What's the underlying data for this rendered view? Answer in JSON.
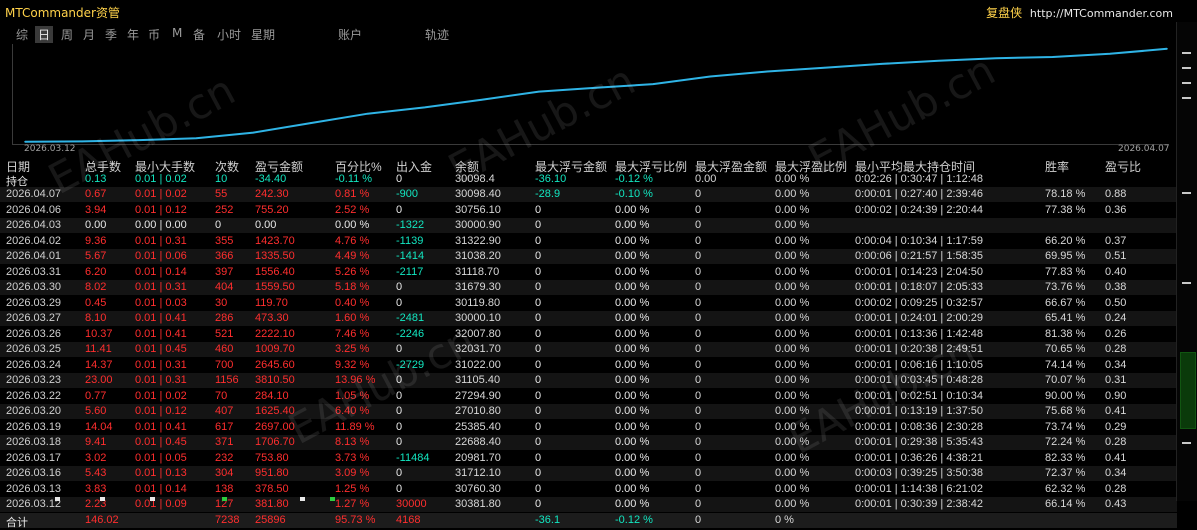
{
  "window": {
    "title": "MTCommander资管",
    "brand": "复盘侠",
    "url": "http://MTCommander.com"
  },
  "tabs": [
    "综",
    "日",
    "周",
    "月",
    "季",
    "年",
    "币",
    "M",
    "备",
    "小时",
    "星期",
    "账户",
    "轨迹"
  ],
  "active_tab": "日",
  "chart_data": {
    "type": "line",
    "x_start_label": "2026.03.12",
    "x_end_label": "2026.04.07",
    "x": [
      "2026.03.12",
      "2026.03.13",
      "2026.03.16",
      "2026.03.17",
      "2026.03.18",
      "2026.03.19",
      "2026.03.20",
      "2026.03.22",
      "2026.03.23",
      "2026.03.24",
      "2026.03.25",
      "2026.03.26",
      "2026.03.27",
      "2026.03.29",
      "2026.03.30",
      "2026.03.31",
      "2026.04.01",
      "2026.04.02",
      "2026.04.03",
      "2026.04.06",
      "2026.04.07"
    ],
    "values": [
      0.4,
      0.9,
      3,
      6,
      15,
      30,
      45,
      55,
      67,
      80,
      86,
      92,
      104,
      112,
      118,
      124,
      129,
      133,
      135,
      140,
      148
    ],
    "line_color": "#2fb4e6",
    "grid": false
  },
  "table": {
    "headers": [
      "日期",
      "总手数",
      "最小大手数",
      "次数",
      "盈亏金额",
      "百分比%",
      "出入金",
      "余额",
      "最大浮亏金额",
      "最大浮亏比例",
      "最大浮盈金额",
      "最大浮盈比例",
      "最小平均最大持仓时间",
      "胜率",
      "盈亏比"
    ],
    "holding": [
      "持仓",
      "0.13",
      "0.01 | 0.02",
      "10",
      "-34.40",
      "-0.11 %",
      "0",
      "30098.4",
      "-36.10",
      "-0.12 %",
      "0.00",
      "0.00 %",
      "0:02:26 | 0:30:47 | 1:12:48",
      "",
      ""
    ],
    "rows": [
      [
        "2026.04.07",
        "0.67",
        "0.01 | 0.02",
        "55",
        "242.30",
        "0.81 %",
        "-900",
        "30098.40",
        "-28.9",
        "-0.10 %",
        "0",
        "0.00 %",
        "0:00:01 | 0:27:40 | 2:39:46",
        "78.18 %",
        "0.88"
      ],
      [
        "2026.04.06",
        "3.94",
        "0.01 | 0.12",
        "252",
        "755.20",
        "2.52 %",
        "0",
        "30756.10",
        "0",
        "0.00 %",
        "0",
        "0.00 %",
        "0:00:02 | 0:24:39 | 2:20:44",
        "77.38 %",
        "0.36"
      ],
      [
        "2026.04.03",
        "0.00",
        "0.00 | 0.00",
        "0",
        "0.00",
        "0.00 %",
        "-1322",
        "30000.90",
        "0",
        "0.00 %",
        "0",
        "0.00 %",
        "",
        "",
        ""
      ],
      [
        "2026.04.02",
        "9.36",
        "0.01 | 0.31",
        "355",
        "1423.70",
        "4.76 %",
        "-1139",
        "31322.90",
        "0",
        "0.00 %",
        "0",
        "0.00 %",
        "0:00:04 | 0:10:34 | 1:17:59",
        "66.20 %",
        "0.37"
      ],
      [
        "2026.04.01",
        "5.67",
        "0.01 | 0.06",
        "366",
        "1335.50",
        "4.49 %",
        "-1414",
        "31038.20",
        "0",
        "0.00 %",
        "0",
        "0.00 %",
        "0:00:06 | 0:21:57 | 1:58:35",
        "69.95 %",
        "0.51"
      ],
      [
        "2026.03.31",
        "6.20",
        "0.01 | 0.14",
        "397",
        "1556.40",
        "5.26 %",
        "-2117",
        "31118.70",
        "0",
        "0.00 %",
        "0",
        "0.00 %",
        "0:00:01 | 0:14:23 | 2:04:50",
        "77.83 %",
        "0.40"
      ],
      [
        "2026.03.30",
        "8.02",
        "0.01 | 0.31",
        "404",
        "1559.50",
        "5.18 %",
        "0",
        "31679.30",
        "0",
        "0.00 %",
        "0",
        "0.00 %",
        "0:00:01 | 0:18:07 | 2:05:33",
        "73.76 %",
        "0.38"
      ],
      [
        "2026.03.29",
        "0.45",
        "0.01 | 0.03",
        "30",
        "119.70",
        "0.40 %",
        "0",
        "30119.80",
        "0",
        "0.00 %",
        "0",
        "0.00 %",
        "0:00:02 | 0:09:25 | 0:32:57",
        "66.67 %",
        "0.50"
      ],
      [
        "2026.03.27",
        "8.10",
        "0.01 | 0.41",
        "286",
        "473.30",
        "1.60 %",
        "-2481",
        "30000.10",
        "0",
        "0.00 %",
        "0",
        "0.00 %",
        "0:00:01 | 0:24:01 | 2:00:29",
        "65.41 %",
        "0.24"
      ],
      [
        "2026.03.26",
        "10.37",
        "0.01 | 0.41",
        "521",
        "2222.10",
        "7.46 %",
        "-2246",
        "32007.80",
        "0",
        "0.00 %",
        "0",
        "0.00 %",
        "0:00:01 | 0:13:36 | 1:42:48",
        "81.38 %",
        "0.26"
      ],
      [
        "2026.03.25",
        "11.41",
        "0.01 | 0.45",
        "460",
        "1009.70",
        "3.25 %",
        "0",
        "32031.70",
        "0",
        "0.00 %",
        "0",
        "0.00 %",
        "0:00:01 | 0:20:38 | 2:49:51",
        "70.65 %",
        "0.28"
      ],
      [
        "2026.03.24",
        "14.37",
        "0.01 | 0.31",
        "700",
        "2645.60",
        "9.32 %",
        "-2729",
        "31022.00",
        "0",
        "0.00 %",
        "0",
        "0.00 %",
        "0:00:01 | 0:06:16 | 1:10:05",
        "74.14 %",
        "0.34"
      ],
      [
        "2026.03.23",
        "23.00",
        "0.01 | 0.31",
        "1156",
        "3810.50",
        "13.96 %",
        "0",
        "31105.40",
        "0",
        "0.00 %",
        "0",
        "0.00 %",
        "0:00:01 | 0:03:45 | 0:48:28",
        "70.07 %",
        "0.31"
      ],
      [
        "2026.03.22",
        "0.77",
        "0.01 | 0.02",
        "70",
        "284.10",
        "1.05 %",
        "0",
        "27294.90",
        "0",
        "0.00 %",
        "0",
        "0.00 %",
        "0:00:01 | 0:02:51 | 0:10:34",
        "90.00 %",
        "0.90"
      ],
      [
        "2026.03.20",
        "5.60",
        "0.01 | 0.12",
        "407",
        "1625.40",
        "6.40 %",
        "0",
        "27010.80",
        "0",
        "0.00 %",
        "0",
        "0.00 %",
        "0:00:01 | 0:13:19 | 1:37:50",
        "75.68 %",
        "0.41"
      ],
      [
        "2026.03.19",
        "14.04",
        "0.01 | 0.41",
        "617",
        "2697.00",
        "11.89 %",
        "0",
        "25385.40",
        "0",
        "0.00 %",
        "0",
        "0.00 %",
        "0:00:01 | 0:08:36 | 2:30:28",
        "73.74 %",
        "0.29"
      ],
      [
        "2026.03.18",
        "9.41",
        "0.01 | 0.45",
        "371",
        "1706.70",
        "8.13 %",
        "0",
        "22688.40",
        "0",
        "0.00 %",
        "0",
        "0.00 %",
        "0:00:01 | 0:29:38 | 5:35:43",
        "72.24 %",
        "0.28"
      ],
      [
        "2026.03.17",
        "3.02",
        "0.01 | 0.05",
        "232",
        "753.80",
        "3.73 %",
        "-11484",
        "20981.70",
        "0",
        "0.00 %",
        "0",
        "0.00 %",
        "0:00:01 | 0:36:26 | 4:38:21",
        "82.33 %",
        "0.41"
      ],
      [
        "2026.03.16",
        "5.43",
        "0.01 | 0.13",
        "304",
        "951.80",
        "3.09 %",
        "0",
        "31712.10",
        "0",
        "0.00 %",
        "0",
        "0.00 %",
        "0:00:03 | 0:39:25 | 3:50:38",
        "72.37 %",
        "0.34"
      ],
      [
        "2026.03.13",
        "3.83",
        "0.01 | 0.14",
        "138",
        "378.50",
        "1.25 %",
        "0",
        "30760.30",
        "0",
        "0.00 %",
        "0",
        "0.00 %",
        "0:00:01 | 1:14:38 | 6:21:02",
        "62.32 %",
        "0.28"
      ],
      [
        "2026.03.12",
        "2.23",
        "0.01 | 0.09",
        "127",
        "381.80",
        "1.27 %",
        "30000",
        "30381.80",
        "0",
        "0.00 %",
        "0",
        "0.00 %",
        "0:00:01 | 0:30:39 | 2:38:42",
        "66.14 %",
        "0.43"
      ]
    ],
    "total": [
      "合计",
      "146.02",
      "",
      "7238",
      "25896",
      "95.73 %",
      "4168",
      "",
      "-36.1",
      "-0.12 %",
      "0",
      "0 %",
      "",
      "",
      ""
    ]
  },
  "watermark": "EAHub.cn",
  "colors": {
    "positive": "#ff2e2e",
    "negative": "#12e6c0",
    "title": "#ffd24a",
    "line": "#2fb4e6"
  }
}
